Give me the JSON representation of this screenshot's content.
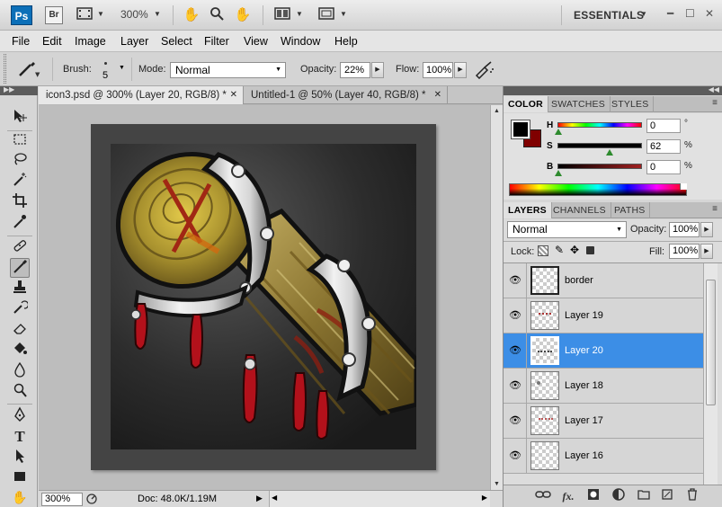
{
  "appbar": {
    "app_logo": "Ps",
    "bridge_logo": "Br",
    "zoom_level": "300%",
    "workspace": "ESSENTIALS",
    "icons": [
      "film-strip-icon",
      "hand-icon",
      "zoom-icon",
      "rotate-view-icon",
      "arrange-documents-icon",
      "screen-mode-icon"
    ]
  },
  "menu": [
    "File",
    "Edit",
    "Image",
    "Layer",
    "Select",
    "Filter",
    "View",
    "Window",
    "Help"
  ],
  "options": {
    "brush_label": "Brush:",
    "brush_size": "5",
    "mode_label": "Mode:",
    "mode_value": "Normal",
    "opacity_label": "Opacity:",
    "opacity_value": "22%",
    "flow_label": "Flow:",
    "flow_value": "100%"
  },
  "tabs": [
    {
      "label": "icon3.psd @ 300% (Layer 20, RGB/8) *",
      "close": "✕",
      "active": true
    },
    {
      "label": "Untitled-1 @ 50% (Layer 40, RGB/8) *",
      "close": "✕",
      "active": false
    }
  ],
  "tools": [
    "move-tool-icon",
    "marquee-tool-icon",
    "lasso-tool-icon",
    "magic-wand-tool-icon",
    "crop-tool-icon",
    "eyedropper-tool-icon",
    "healing-brush-tool-icon",
    "brush-tool-icon",
    "clone-stamp-tool-icon",
    "history-brush-tool-icon",
    "eraser-tool-icon",
    "paint-bucket-tool-icon",
    "blur-tool-icon",
    "dodge-tool-icon",
    "pen-tool-icon",
    "type-tool-icon",
    "path-selection-tool-icon",
    "shape-tool-icon",
    "hand-tool-icon"
  ],
  "status": {
    "zoom": "300%",
    "doc_info": "Doc: 48.0K/1.19M"
  },
  "color_panel": {
    "tabs": [
      "COLOR",
      "SWATCHES",
      "STYLES"
    ],
    "foreground": "#000000",
    "background": "#800000",
    "h_label": "H",
    "h_value": "0",
    "h_unit": "°",
    "h_fraction": 0.0,
    "s_label": "S",
    "s_value": "62",
    "s_unit": "%",
    "s_fraction": 0.62,
    "b_label": "B",
    "b_value": "0",
    "b_unit": "%",
    "b_fraction": 0.0
  },
  "layers_panel": {
    "tabs": [
      "LAYERS",
      "CHANNELS",
      "PATHS"
    ],
    "blend_mode": "Normal",
    "opacity_label": "Opacity:",
    "opacity_value": "100%",
    "lock_label": "Lock:",
    "fill_label": "Fill:",
    "fill_value": "100%",
    "layers": [
      {
        "name": "border",
        "selected": false
      },
      {
        "name": "Layer 19",
        "selected": false
      },
      {
        "name": "Layer 20",
        "selected": true
      },
      {
        "name": "Layer 18",
        "selected": false
      },
      {
        "name": "Layer 17",
        "selected": false
      },
      {
        "name": "Layer 16",
        "selected": false
      }
    ],
    "footer_icons": [
      "link-layers-icon",
      "fx-icon",
      "layer-mask-icon",
      "adjustment-layer-icon",
      "new-group-icon",
      "new-layer-icon",
      "trash-icon"
    ],
    "fx_label": "fx."
  },
  "colors": {
    "selection": "#3c8ee6",
    "artwork_bg": "#2b2b2b",
    "document_border": "#444444"
  }
}
